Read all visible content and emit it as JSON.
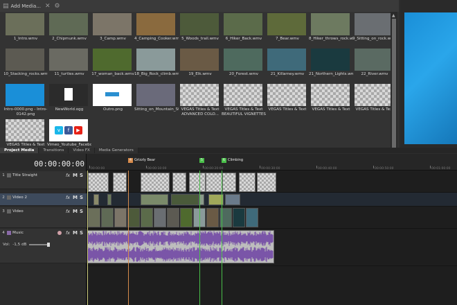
{
  "toolbar": {
    "add_media_label": "Add Media..."
  },
  "media_items": [
    {
      "name": "1_Intro.wmv",
      "color": "#6b6f5a"
    },
    {
      "name": "2_Chipmunk.wmv",
      "color": "#5f6a55"
    },
    {
      "name": "3_Camp.wmv",
      "color": "#7c7568"
    },
    {
      "name": "4_Camping_Cooker.wmv",
      "color": "#8a6a3e"
    },
    {
      "name": "5_Woods_trail.wmv",
      "color": "#4d5a3a"
    },
    {
      "name": "6_Hiker_Back.wmv",
      "color": "#5b6b4a"
    },
    {
      "name": "7_Bear.wmv",
      "color": "#5e6a3a"
    },
    {
      "name": "8_Hiker_throws_rock.wmv",
      "color": "#6d7a60"
    },
    {
      "name": "9_Sitting_on_rock.wmv",
      "color": "#6a6e72"
    },
    {
      "name": "10_Stacking_rocks.wmv",
      "color": "#5c5a52"
    },
    {
      "name": "11_turtles.wmv",
      "color": "#6a6a62"
    },
    {
      "name": "17_woman_back.wmv",
      "color": "#4f6a2e"
    },
    {
      "name": "18_Big_Rock_climb.wmv",
      "color": "#8a9a9a"
    },
    {
      "name": "19_Elk.wmv",
      "color": "#6a5a45"
    },
    {
      "name": "20_Forest.wmv",
      "color": "#4e6a5e"
    },
    {
      "name": "21_Killarney.wmv",
      "color": "#3f6a7a"
    },
    {
      "name": "21_Northern_Lights.wmv",
      "color": "#1a3a3f"
    },
    {
      "name": "22_River.wmv",
      "color": "#5a6a62"
    },
    {
      "name": "Intro-0000.png - Intro-0142.png",
      "color": "#1a8fd8"
    },
    {
      "name": "NewWorld.ogg",
      "color": "#ffffff"
    },
    {
      "name": "Outro.png",
      "color": "#ffffff"
    },
    {
      "name": "Sitting_on_Mountain_Still_Image.jpg",
      "color": "#6a6a7a"
    },
    {
      "name": "VEGAS Titles & Text ADVANCED COLO...",
      "color": "checker"
    },
    {
      "name": "VEGAS Titles & Text BEAUTIFUL VIGNETTES",
      "color": "checker"
    },
    {
      "name": "VEGAS Titles & Text",
      "color": "checker"
    },
    {
      "name": "VEGAS Titles & Text",
      "color": "checker"
    },
    {
      "name": "VEGAS Titles & Text",
      "color": "checker"
    },
    {
      "name": "VEGAS Titles & Text",
      "color": "checker"
    },
    {
      "name": "Vimeo_Youtube_Faceboo",
      "color": "social"
    }
  ],
  "tabs": [
    {
      "label": "Project Media"
    },
    {
      "label": "Transitions"
    },
    {
      "label": "Video FX"
    },
    {
      "label": "Media Generators"
    }
  ],
  "timeline": {
    "timecode": "00:00:00:00",
    "markers": [
      {
        "label": "Grizzly Bear",
        "num": "4",
        "color": "#d88c4c"
      },
      {
        "label": "",
        "num": "5",
        "color": "#4ac04a"
      },
      {
        "label": "Climbing",
        "num": "6",
        "color": "#4ac04a"
      }
    ],
    "ruler_ticks": [
      "00:00:00",
      "00:00:10:00",
      "00:00:20:00",
      "00:00:30:00",
      "00:00:40:00",
      "00:00:50:00",
      "00:01:00:00"
    ],
    "tracks": [
      {
        "num": "1",
        "name": "Title Straight",
        "type": "video"
      },
      {
        "num": "2",
        "name": "Video 2",
        "type": "video",
        "selected": true
      },
      {
        "num": "3",
        "name": "Video",
        "type": "video"
      },
      {
        "num": "4",
        "name": "Music",
        "type": "audio",
        "volume": "-1,5 dB",
        "vol_label": "Vol:"
      }
    ],
    "controls": {
      "fx": "fx",
      "mute": "M",
      "solo": "S"
    }
  },
  "colors": {
    "audio_wave": "#7a55a8",
    "playhead": "#d88c4c",
    "marker_green": "#4ac04a",
    "preview_blue": "#1a8fd8"
  }
}
